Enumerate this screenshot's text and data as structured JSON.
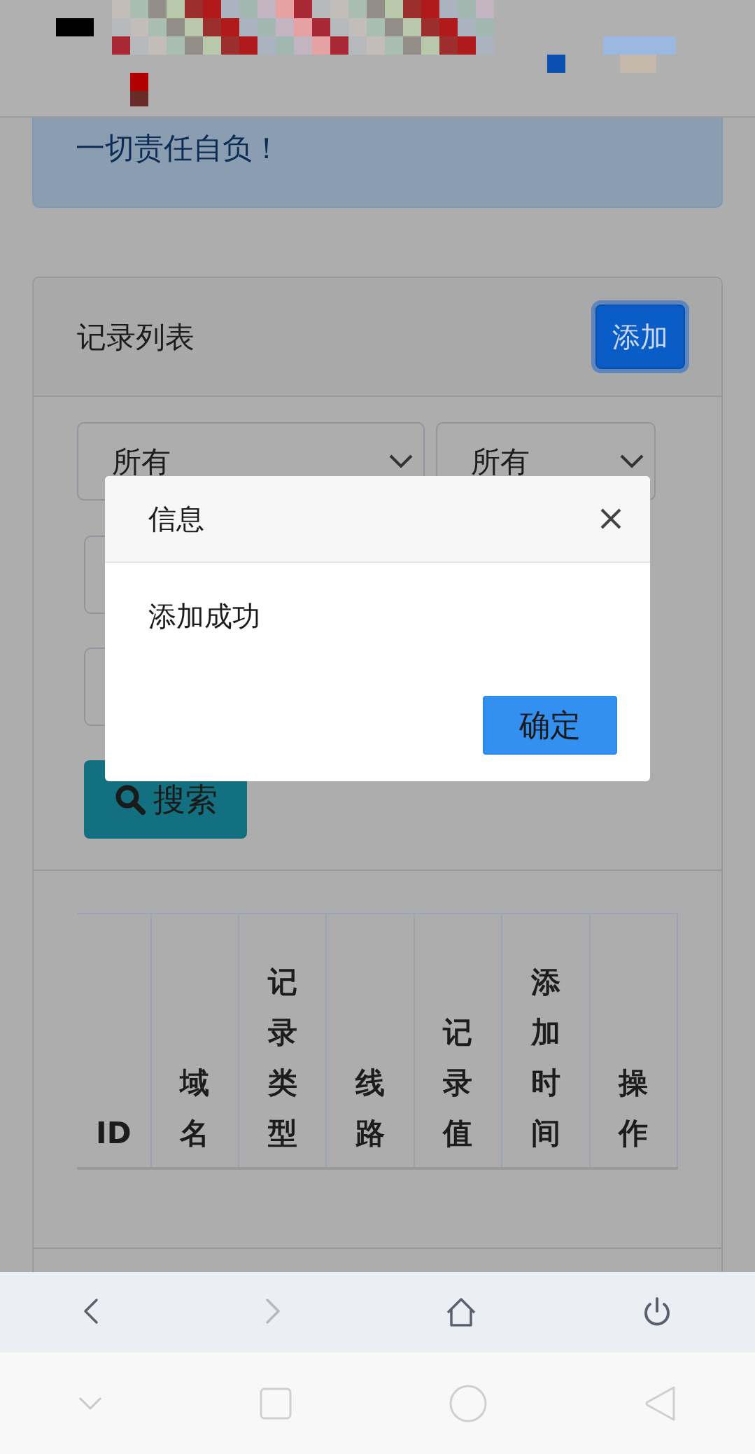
{
  "alert": {
    "text": "一切责任自负！"
  },
  "card": {
    "title": "记录列表",
    "add_button": "添加",
    "filters": [
      {
        "value": "所有"
      },
      {
        "value": "所有"
      }
    ],
    "search_button": "搜索",
    "table": {
      "columns": [
        "ID",
        "域名",
        "记录类型",
        "线路",
        "记录值",
        "添加时间",
        "操作"
      ]
    }
  },
  "modal": {
    "title": "信息",
    "message": "添加成功",
    "confirm_button": "确定"
  },
  "browser_toolbar": [
    {
      "kind": "back",
      "disabled": false
    },
    {
      "kind": "forward",
      "disabled": true
    },
    {
      "kind": "home",
      "disabled": false
    },
    {
      "kind": "power",
      "disabled": false
    }
  ]
}
